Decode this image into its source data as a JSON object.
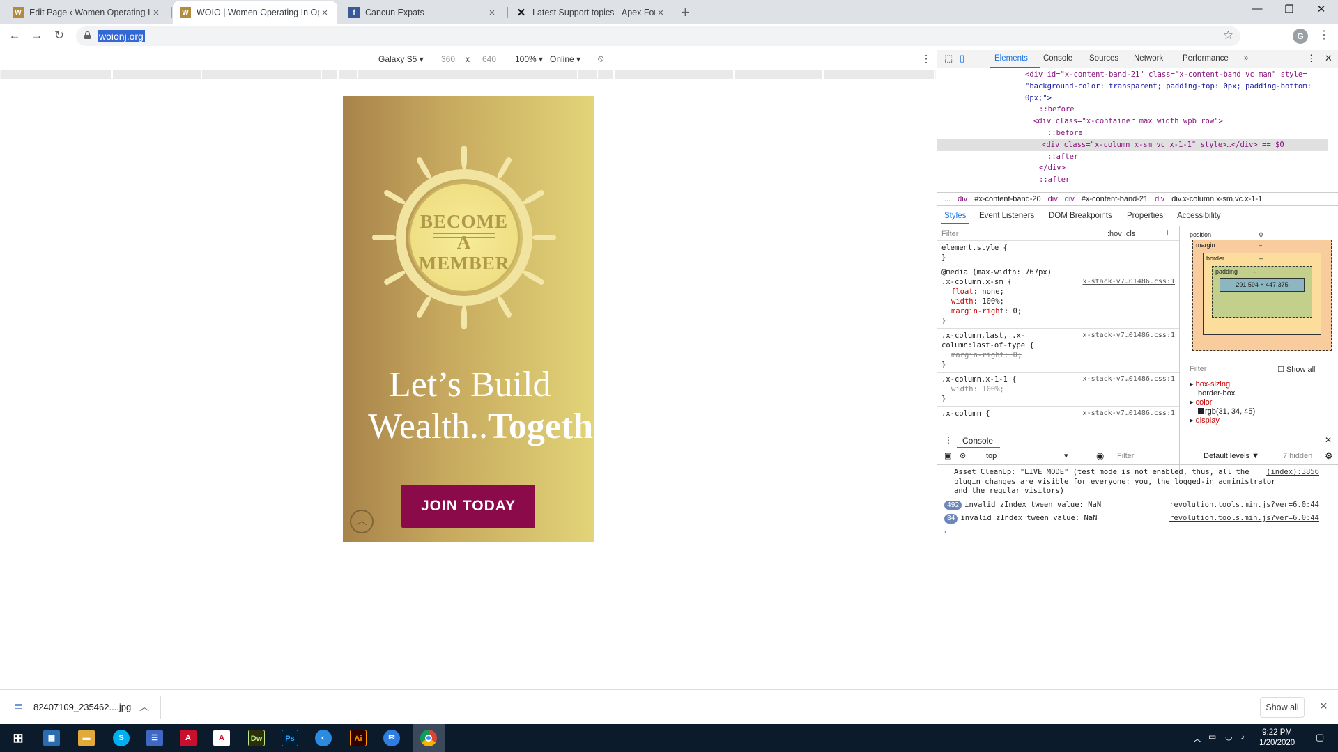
{
  "tabs": [
    {
      "title": "Edit Page ‹ Women Operating In",
      "favicon": "woio-icon"
    },
    {
      "title": "WOIO | Women Operating In Op",
      "favicon": "woio-icon"
    },
    {
      "title": "Cancun Expats",
      "favicon": "facebook-icon"
    },
    {
      "title": "Latest Support topics - Apex For",
      "favicon": "x-icon"
    }
  ],
  "address": {
    "url": "woionj.org",
    "profile_initial": "G"
  },
  "device_toolbar": {
    "device": "Galaxy S5",
    "width": "360",
    "x": "x",
    "height": "640",
    "zoom": "100%",
    "network": "Online"
  },
  "page": {
    "emblem_lines": [
      "BECOME",
      "A",
      "MEMBER"
    ],
    "headline_line1": "Let’s Build",
    "headline_line2_regular": "Wealth..",
    "headline_line2_bold": "Together",
    "join_button": "JOIN TODAY"
  },
  "devtools": {
    "tabs": [
      "Elements",
      "Console",
      "Sources",
      "Network",
      "Performance"
    ],
    "dom_lines": [
      "<div id=\"x-content-band-21\" class=\"x-content-band vc man\" style=",
      "\"background-color: transparent; padding-top: 0px; padding-bottom:",
      "0px;\">",
      "::before",
      "<div class=\"x-container max width wpb_row\">",
      "::before",
      "<div class=\"x-column x-sm vc x-1-1\" style>…</div> == $0",
      "::after",
      "</div>",
      "::after"
    ],
    "breadcrumbs": [
      "...",
      "div",
      "#x-content-band-20",
      "div",
      "div",
      "#x-content-band-21",
      "div",
      "div.x-column.x-sm.vc.x-1-1"
    ],
    "styles_tabs": [
      "Styles",
      "Event Listeners",
      "DOM Breakpoints",
      "Properties",
      "Accessibility"
    ],
    "styles_filter": "Filter",
    "hov": ":hov .cls",
    "rules": [
      {
        "selector": "element.style {",
        "src": "",
        "props": []
      },
      {
        "selector": "@media (max-width: 767px)\n.x-column.x-sm {",
        "src": "x-stack-v7…01486.css:1",
        "props": [
          [
            "float",
            "none;"
          ],
          [
            "width",
            "100%;"
          ],
          [
            "margin-right",
            "0;"
          ]
        ]
      },
      {
        "selector": ".x-column.last, .x-\ncolumn:last-of-type {",
        "src": "x-stack-v7…01486.css:1",
        "props": [
          [
            "margin-right",
            "0;"
          ]
        ],
        "struck": true
      },
      {
        "selector": ".x-column.x-1-1 {",
        "src": "x-stack-v7…01486.css:1",
        "props": [
          [
            "width",
            "100%;"
          ]
        ],
        "struck": true
      },
      {
        "selector": ".x-column {",
        "src": "x-stack-v7…01486.css:1",
        "props": []
      }
    ],
    "box_model": {
      "position": "position",
      "margin": "margin",
      "border": "border",
      "padding": "padding",
      "content": "291.594 × 447.375",
      "zero": "0",
      "dash": "–"
    },
    "computed": {
      "filter": "Filter",
      "show_all": "Show all",
      "items": [
        [
          "box-sizing",
          "border-box"
        ],
        [
          "color",
          "rgb(31, 34, 45)"
        ],
        [
          "display",
          ""
        ]
      ]
    },
    "console": {
      "title": "Console",
      "context": "top",
      "filter": "Filter",
      "levels": "Default levels ▼",
      "hidden": "7 hidden",
      "messages": [
        {
          "count": "",
          "text": "Asset CleanUp: \"LIVE MODE\" (test mode is not enabled, thus, all the plugin changes are visible for everyone: you, the logged-in administrator and the regular visitors)",
          "src": "(index):3856"
        },
        {
          "count": "492",
          "text": "invalid zIndex tween value: NaN",
          "src": "revolution.tools.min.js?ver=6.0:44"
        },
        {
          "count": "84",
          "text": "invalid zIndex tween value: NaN",
          "src": "revolution.tools.min.js?ver=6.0:44"
        }
      ]
    }
  },
  "download": {
    "filename": "82407109_235462....jpg",
    "show_all": "Show all"
  },
  "taskbar": {
    "time": "9:22 PM",
    "date": "1/20/2020"
  },
  "colors": {
    "join_button": "#8b0a4a",
    "gold_dark": "#a8834a",
    "gold_light": "#e2d478",
    "devtools_accent": "#1a73e8",
    "taskbar": "#0b1b2c"
  }
}
